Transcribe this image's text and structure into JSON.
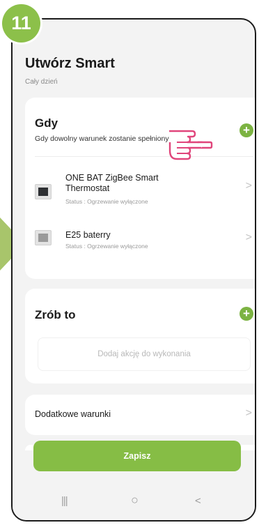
{
  "step_badge": "11",
  "header": {
    "title": "Utwórz Smart",
    "subtitle": "Cały dzień"
  },
  "when_card": {
    "heading": "Gdy",
    "condition_text": "Gdy dowolny warunek zostanie spełniony",
    "condition_arrow": "▾",
    "devices": [
      {
        "name": "ONE BAT ZigBee Smart Thermostat",
        "status": "Status : Ogrzewanie wyłączone",
        "icon": "thermostat-icon"
      },
      {
        "name": "E25 baterry",
        "status": "Status : Ogrzewanie wyłączone",
        "icon": "thermostat-icon"
      }
    ]
  },
  "do_card": {
    "heading": "Zrób to",
    "placeholder": "Dodaj akcję do wykonania"
  },
  "extra_card": {
    "label": "Dodatkowe warunki"
  },
  "save_button": {
    "label": "Zapisz"
  },
  "navbar": {
    "recent": "|||",
    "home": "○",
    "back": "<"
  },
  "glyphs": {
    "plus": "+",
    "chevron": ">"
  },
  "colors": {
    "accent_green": "#7cb342",
    "badge_green": "#8cc04a",
    "arrow_green": "#a8c56b",
    "hand_pointer": "#e0457b"
  }
}
